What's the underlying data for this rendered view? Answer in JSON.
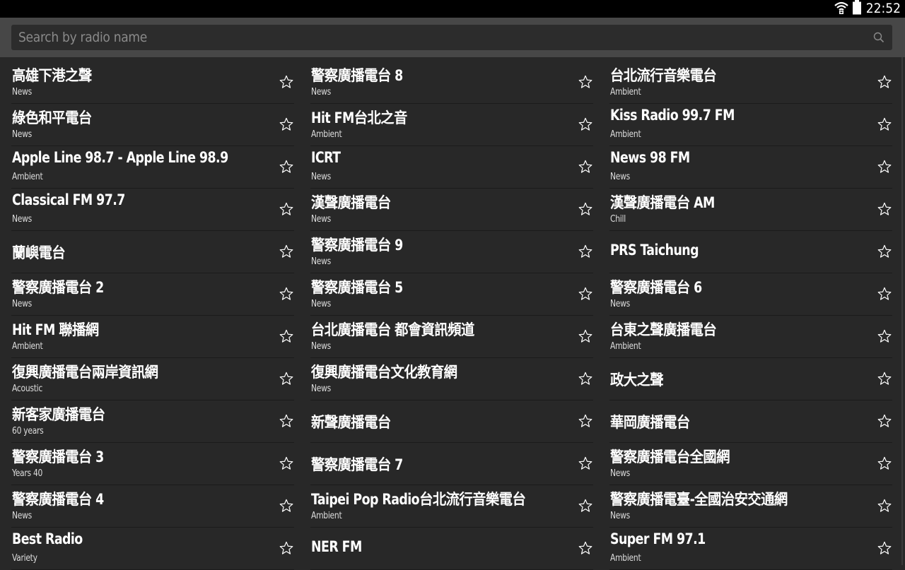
{
  "status_bar": {
    "time": "22:52",
    "icons": [
      "wifi-icon",
      "battery-icon"
    ]
  },
  "search": {
    "placeholder": "Search by radio name",
    "icon": "search-icon"
  },
  "colors": {
    "background": "#282828",
    "toolbar": "#474747",
    "status_bar": "#000000",
    "text": "#ffffff",
    "placeholder": "#8a8a8a"
  },
  "columns": [
    [
      {
        "name": "高雄下港之聲",
        "genre": "News"
      },
      {
        "name": "綠色和平電台",
        "genre": "News"
      },
      {
        "name": "Apple Line 98.7 - Apple Line 98.9",
        "genre": "Ambient"
      },
      {
        "name": "Classical FM 97.7",
        "genre": "News"
      },
      {
        "name": "蘭嶼電台",
        "genre": ""
      },
      {
        "name": "警察廣播電台 2",
        "genre": "News"
      },
      {
        "name": "Hit FM 聯播網",
        "genre": "Ambient"
      },
      {
        "name": "復興廣播電台兩岸資訊網",
        "genre": "Acoustic"
      },
      {
        "name": "新客家廣播電台",
        "genre": "60 years"
      },
      {
        "name": "警察廣播電台 3",
        "genre": "Years 40"
      },
      {
        "name": "警察廣播電台 4",
        "genre": "News"
      },
      {
        "name": "Best Radio",
        "genre": "Variety"
      }
    ],
    [
      {
        "name": "警察廣播電台 8",
        "genre": "News"
      },
      {
        "name": "Hit FM台北之音",
        "genre": "Ambient"
      },
      {
        "name": "ICRT",
        "genre": "News"
      },
      {
        "name": "漢聲廣播電台",
        "genre": "News"
      },
      {
        "name": "警察廣播電台 9",
        "genre": "News"
      },
      {
        "name": "警察廣播電台 5",
        "genre": "News"
      },
      {
        "name": "台北廣播電台 都會資訊頻道",
        "genre": "News"
      },
      {
        "name": "復興廣播電台文化教育網",
        "genre": "News"
      },
      {
        "name": "新聲廣播電台",
        "genre": ""
      },
      {
        "name": "警察廣播電台 7",
        "genre": ""
      },
      {
        "name": "Taipei Pop Radio台北流行音樂電台",
        "genre": "Ambient"
      },
      {
        "name": "NER FM",
        "genre": ""
      }
    ],
    [
      {
        "name": "台北流行音樂電台",
        "genre": "Ambient"
      },
      {
        "name": "Kiss Radio 99.7 FM",
        "genre": "Ambient"
      },
      {
        "name": "News 98 FM",
        "genre": "News"
      },
      {
        "name": "漢聲廣播電台 AM",
        "genre": "Chill"
      },
      {
        "name": "PRS Taichung",
        "genre": ""
      },
      {
        "name": "警察廣播電台 6",
        "genre": "News"
      },
      {
        "name": "台東之聲廣播電台",
        "genre": "Ambient"
      },
      {
        "name": "政大之聲",
        "genre": ""
      },
      {
        "name": "華岡廣播電台",
        "genre": ""
      },
      {
        "name": "警察廣播電台全國網",
        "genre": "News"
      },
      {
        "name": "警察廣播電臺-全國治安交通網",
        "genre": "News"
      },
      {
        "name": "Super FM 97.1",
        "genre": "Ambient"
      }
    ]
  ]
}
